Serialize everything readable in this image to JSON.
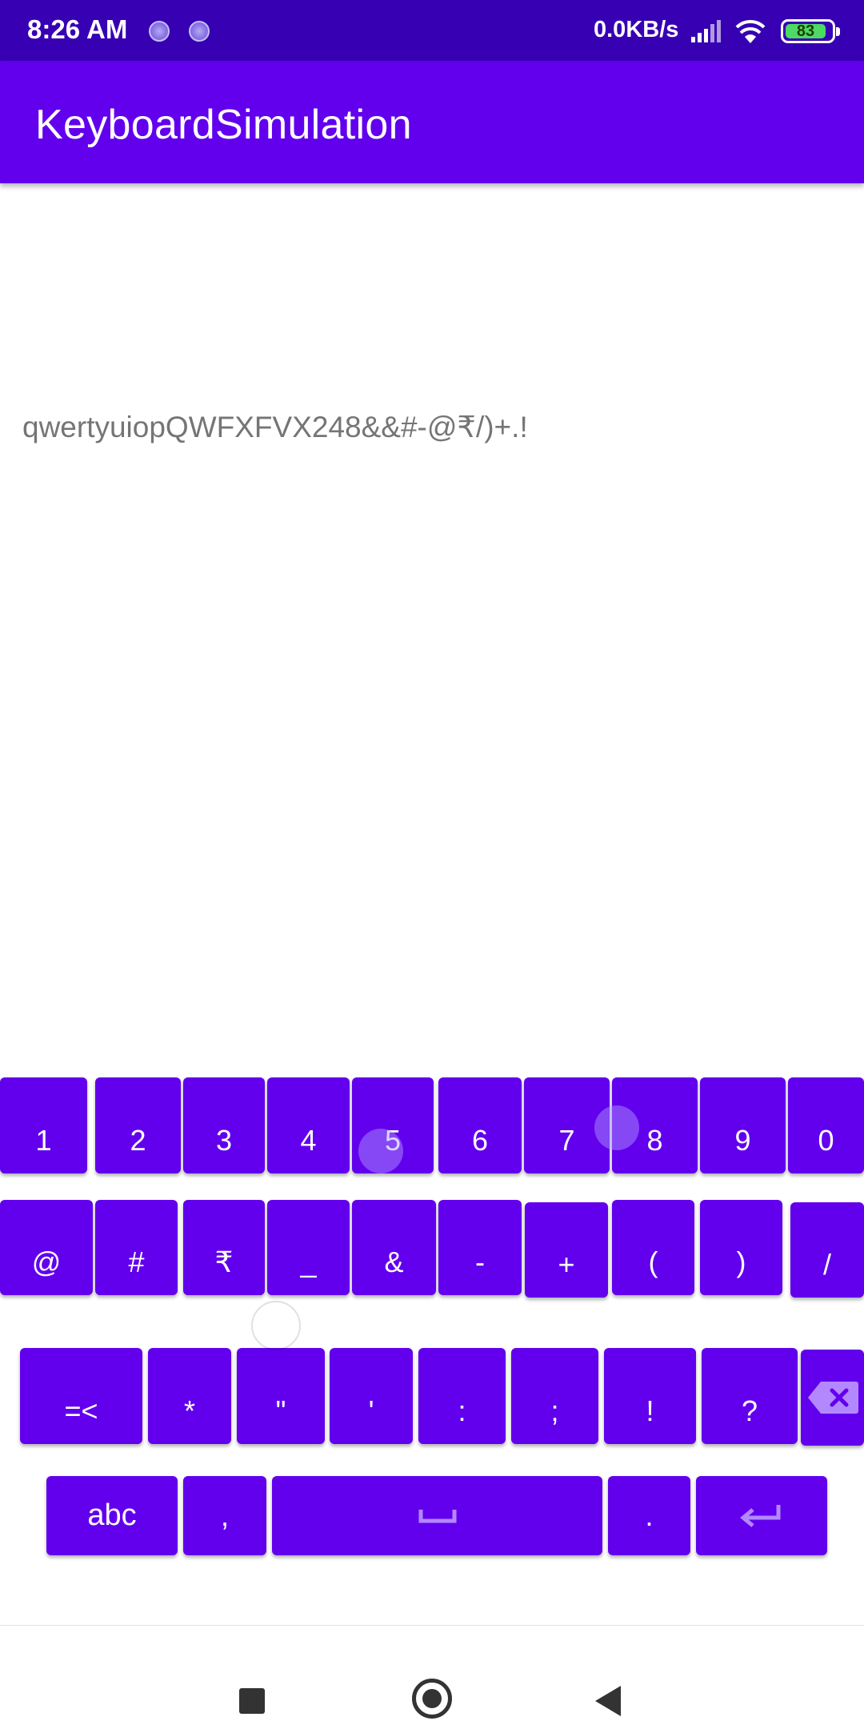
{
  "status_bar": {
    "time": "8:26 AM",
    "speed": "0.0KB/s",
    "battery": "83",
    "icons": [
      "notification-dot-icon",
      "notification-dot-icon",
      "signal-icon",
      "wifi-icon",
      "battery-icon"
    ]
  },
  "app_bar": {
    "title": "KeyboardSimulation"
  },
  "editor": {
    "text": "qwertyuiopQWFXFVX248&&#-@₹/)+.!"
  },
  "keyboard": {
    "colors": {
      "key": "#6200ee",
      "label": "#ffffff",
      "backspace_icon": "#b388ff"
    },
    "row1": [
      "1",
      "2",
      "3",
      "4",
      "5",
      "6",
      "7",
      "8",
      "9",
      "0"
    ],
    "row2": [
      "@",
      "#",
      "₹",
      "_",
      "&",
      "-",
      "+",
      "(",
      ")",
      "/"
    ],
    "row3": [
      "=<",
      "*",
      "\"",
      "'",
      ":",
      ";",
      "!",
      "?"
    ],
    "row4": {
      "abc": "abc",
      "comma": ",",
      "period": "."
    },
    "icons": {
      "backspace": "backspace-icon",
      "space": "space-bar-icon",
      "enter": "enter-icon"
    }
  },
  "nav_bar": {
    "icons": [
      "recents-square-icon",
      "home-circle-icon",
      "back-triangle-icon"
    ]
  }
}
